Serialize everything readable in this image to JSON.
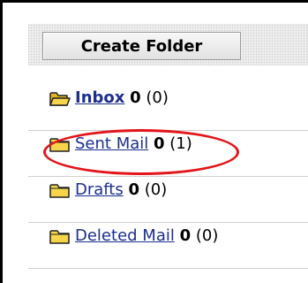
{
  "toolbar": {
    "create_folder_label": "Create Folder"
  },
  "folders": [
    {
      "name": "Inbox",
      "count": "0",
      "total": "(0)",
      "icon": "open-folder-icon"
    },
    {
      "name": "Sent Mail",
      "count": "0",
      "total": "(1)",
      "icon": "folder-icon"
    },
    {
      "name": "Drafts",
      "count": "0",
      "total": "(0)",
      "icon": "folder-icon"
    },
    {
      "name": "Deleted Mail",
      "count": "0",
      "total": "(0)",
      "icon": "folder-icon"
    }
  ],
  "colors": {
    "link": "#1d2f8e",
    "annotation": "#e3141a",
    "folder_fill": "#f7d54a"
  }
}
